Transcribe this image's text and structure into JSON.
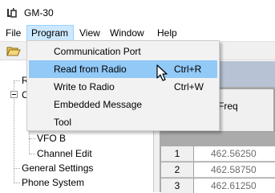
{
  "window": {
    "title": "GM-30",
    "icon": "radio-app-icon"
  },
  "menubar": {
    "file": "File",
    "program": "Program",
    "view": "View",
    "window": "Window",
    "help": "Help"
  },
  "toolbar": {
    "open_icon": "open-folder-icon"
  },
  "program_menu": {
    "items": [
      {
        "label": "Communication Port",
        "shortcut": ""
      },
      {
        "label": "Read from Radio",
        "shortcut": "Ctrl+R"
      },
      {
        "label": "Write to Radio",
        "shortcut": "Ctrl+W"
      },
      {
        "label": "Embedded Message",
        "shortcut": ""
      },
      {
        "label": "Tool",
        "shortcut": ""
      }
    ],
    "highlighted_index": 1
  },
  "tree": {
    "partial_r": "R",
    "partial_c": "C",
    "vfo_b": "VFO B",
    "channel_edit": "Channel Edit",
    "general_settings": "General Settings",
    "phone_system": "Phone System"
  },
  "grid": {
    "column_header": "RX Freq",
    "rows": [
      {
        "num": "1",
        "freq": "462.56250"
      },
      {
        "num": "2",
        "freq": "462.58750"
      },
      {
        "num": "3",
        "freq": "462.61250"
      }
    ]
  },
  "colors": {
    "menu_highlight": "#91c9f7",
    "menubar_active": "#cce8ff",
    "grid_background": "#ababab",
    "grid_top": "#b7c3d4"
  }
}
